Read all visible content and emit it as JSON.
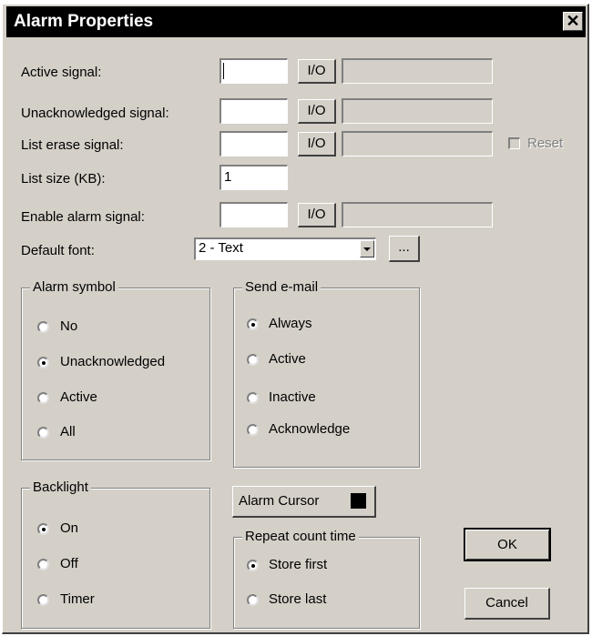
{
  "window": {
    "title": "Alarm Properties",
    "close_glyph": "✕"
  },
  "signals": {
    "active_label": "Active signal:",
    "unack_label": "Unacknowledged signal:",
    "erase_label": "List erase signal:",
    "list_size_label": "List size (KB):",
    "list_size_value": "1",
    "enable_label": "Enable alarm signal:",
    "io_label": "I/O",
    "reset_label": "Reset"
  },
  "font": {
    "label": "Default font:",
    "value": "2 - Text",
    "browse_label": "..."
  },
  "alarm_symbol": {
    "legend": "Alarm symbol",
    "options": [
      "No",
      "Unacknowledged",
      "Active",
      "All"
    ],
    "selected": "Unacknowledged"
  },
  "send_email": {
    "legend": "Send e-mail",
    "options": [
      "Always",
      "Active",
      "Inactive",
      "Acknowledge"
    ],
    "selected": "Always"
  },
  "backlight": {
    "legend": "Backlight",
    "options": [
      "On",
      "Off",
      "Timer"
    ],
    "selected": "On"
  },
  "alarm_cursor": {
    "label": "Alarm Cursor",
    "color": "#000000"
  },
  "repeat_count": {
    "legend": "Repeat count time",
    "options": [
      "Store first",
      "Store last"
    ],
    "selected": "Store first"
  },
  "buttons": {
    "ok": "OK",
    "cancel": "Cancel"
  }
}
